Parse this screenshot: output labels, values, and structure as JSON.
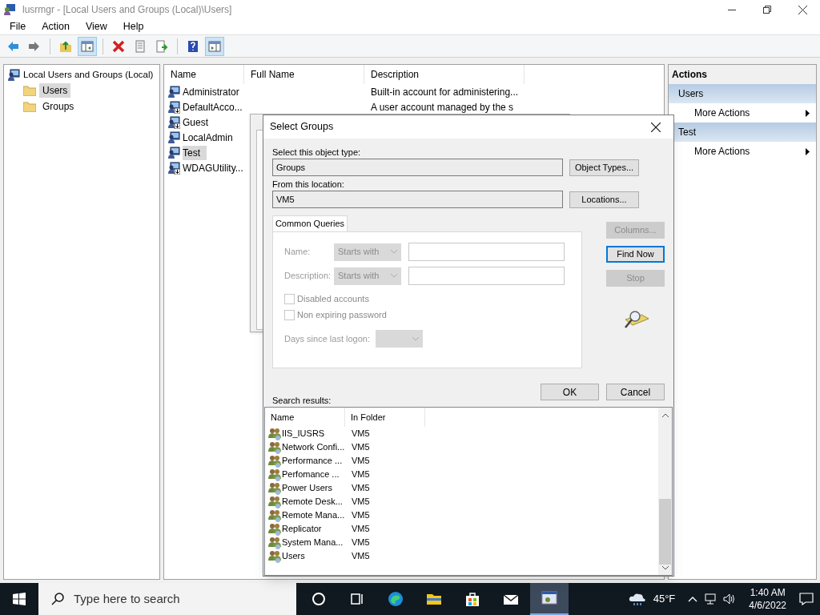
{
  "window": {
    "title": "lusrmgr - [Local Users and Groups (Local)\\Users]"
  },
  "menu": [
    "File",
    "Action",
    "View",
    "Help"
  ],
  "toolbar": [
    {
      "kind": "back",
      "pressed": false
    },
    {
      "kind": "forward",
      "pressed": false
    },
    {
      "kind": "sep"
    },
    {
      "kind": "up",
      "pressed": false
    },
    {
      "kind": "tree",
      "pressed": true
    },
    {
      "kind": "sep"
    },
    {
      "kind": "delete",
      "pressed": false
    },
    {
      "kind": "properties",
      "pressed": false
    },
    {
      "kind": "export",
      "pressed": false
    },
    {
      "kind": "sep"
    },
    {
      "kind": "help",
      "pressed": false
    },
    {
      "kind": "actionpane",
      "pressed": true
    }
  ],
  "tree": {
    "label": "Local Users and Groups (Local)",
    "children": [
      {
        "label": "Users",
        "selected": true
      },
      {
        "label": "Groups",
        "selected": false
      }
    ]
  },
  "list": {
    "columns": [
      "Name",
      "Full Name",
      "Description"
    ],
    "rows": [
      {
        "name": "Administrator",
        "description": "Built-in account for administering...",
        "disabled": false,
        "selected": false
      },
      {
        "name": "DefaultAcco...",
        "description": "A user account managed by the s",
        "disabled": true,
        "selected": false
      },
      {
        "name": "Guest",
        "disabled": true,
        "selected": false
      },
      {
        "name": "LocalAdmin",
        "disabled": false,
        "selected": false
      },
      {
        "name": "Test",
        "disabled": false,
        "selected": true
      },
      {
        "name": "WDAGUtility...",
        "disabled": true,
        "selected": false
      }
    ]
  },
  "actions": {
    "title": "Actions",
    "sections": [
      {
        "title": "Users",
        "items": [
          "More Actions"
        ]
      },
      {
        "title": "Test",
        "items": [
          "More Actions"
        ]
      }
    ]
  },
  "dialog": {
    "title": "Select Groups",
    "object_type": {
      "label": "Select this object type:",
      "value": "Groups",
      "button": "Object Types..."
    },
    "location": {
      "label": "From this location:",
      "value": "VM5",
      "button": "Locations..."
    },
    "tab": "Common Queries",
    "queries": {
      "name_label": "Name:",
      "name_op": "Starts with",
      "description_label": "Description:",
      "description_op": "Starts with",
      "checkboxes": [
        {
          "label": "Disabled accounts",
          "checked": false
        },
        {
          "label": "Non expiring password",
          "checked": false
        }
      ],
      "days_label": "Days since last logon:"
    },
    "side_buttons": [
      {
        "label": "Columns...",
        "disabled": true,
        "default": false
      },
      {
        "label": "Find Now",
        "disabled": false,
        "default": true
      },
      {
        "label": "Stop",
        "disabled": true,
        "default": false
      }
    ],
    "ok": "OK",
    "cancel": "Cancel",
    "results_label": "Search results:",
    "results": {
      "columns": [
        "Name",
        "In Folder"
      ],
      "rows": [
        {
          "name": "IIS_IUSRS",
          "folder": "VM5"
        },
        {
          "name": "Network Confi...",
          "folder": "VM5"
        },
        {
          "name": "Performance ...",
          "folder": "VM5"
        },
        {
          "name": "Perfomance ...",
          "folder": "VM5"
        },
        {
          "name": "Power Users",
          "folder": "VM5"
        },
        {
          "name": "Remote Desk...",
          "folder": "VM5"
        },
        {
          "name": "Remote Mana...",
          "folder": "VM5"
        },
        {
          "name": "Replicator",
          "folder": "VM5"
        },
        {
          "name": "System Mana...",
          "folder": "VM5"
        },
        {
          "name": "Users",
          "folder": "VM5"
        }
      ]
    }
  },
  "taskbar": {
    "search_placeholder": "Type here to search",
    "apps": [
      {
        "kind": "cortana",
        "active": false
      },
      {
        "kind": "taskview",
        "active": false
      },
      {
        "kind": "edge",
        "active": false
      },
      {
        "kind": "explorer",
        "active": false
      },
      {
        "kind": "store",
        "active": false
      },
      {
        "kind": "mail",
        "active": false
      },
      {
        "kind": "mmc",
        "active": true
      }
    ],
    "temperature": "45°F",
    "time": "1:40 AM",
    "date": "4/6/2022"
  }
}
